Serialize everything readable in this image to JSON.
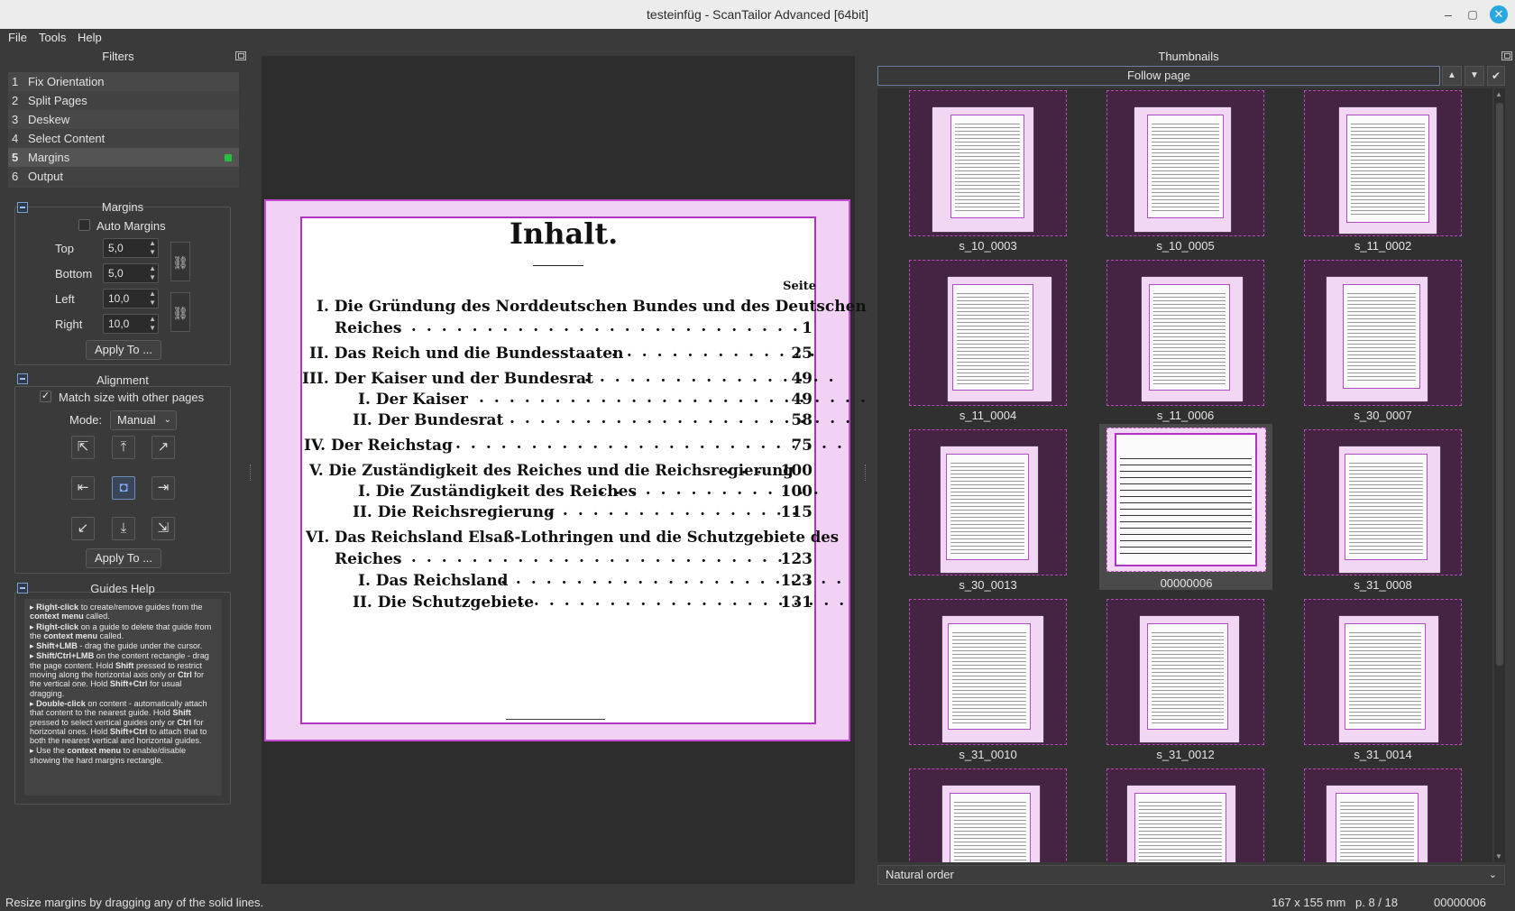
{
  "window": {
    "title": "testeinfüg - ScanTailor Advanced [64bit]"
  },
  "menu": [
    "File",
    "Tools",
    "Help"
  ],
  "filters": {
    "title": "Filters",
    "items": [
      {
        "num": "1",
        "label": "Fix Orientation"
      },
      {
        "num": "2",
        "label": "Split Pages"
      },
      {
        "num": "3",
        "label": "Deskew"
      },
      {
        "num": "4",
        "label": "Select Content"
      },
      {
        "num": "5",
        "label": "Margins"
      },
      {
        "num": "6",
        "label": "Output"
      }
    ],
    "active": "5"
  },
  "margins": {
    "title": "Margins",
    "auto_label": "Auto Margins",
    "top_label": "Top",
    "top": "5,0",
    "bottom_label": "Bottom",
    "bottom": "5,0",
    "left_label": "Left",
    "left": "10,0",
    "right_label": "Right",
    "right": "10,0",
    "apply": "Apply To ..."
  },
  "alignment": {
    "title": "Alignment",
    "match_label": "Match size with other pages",
    "mode_label": "Mode:",
    "mode": "Manual",
    "apply": "Apply To ..."
  },
  "guides": {
    "title": "Guides Help"
  },
  "toc": {
    "title": "Inhalt.",
    "seite": "Seite",
    "e1a": "I. Die Gründung des Norddeutschen Bundes und des Deutschen",
    "e1b": "Reiches",
    "p1": "1",
    "e2": "II. Das Reich und die Bundesstaaten",
    "p2": "25",
    "e3": "III. Der Kaiser und der Bundesrat",
    "p3": "49",
    "e4": "I. Der Kaiser",
    "p4": "49",
    "e5": "II. Der Bundesrat",
    "p5": "58",
    "e6": "IV. Der Reichstag",
    "p6": "75",
    "e7": "V. Die Zuständigkeit des Reiches und die Reichsregierung",
    "p7": "100",
    "e8": "I. Die Zuständigkeit des Reiches",
    "p8": "100",
    "e9": "II. Die Reichsregierung",
    "p9": "115",
    "e10a": "VI. Das Reichsland Elsaß-Lothringen und die Schutzgebiete des",
    "e10b": "Reiches",
    "p10": "123",
    "e11": "I. Das Reichsland",
    "p11": "123",
    "e12": "II. Die Schutzgebiete",
    "p12": "131"
  },
  "thumbnails": {
    "title": "Thumbnails",
    "follow": "Follow page",
    "order": "Natural order",
    "items": [
      "s_10_0003",
      "s_10_0005",
      "s_11_0002",
      "s_11_0004",
      "s_11_0006",
      "s_30_0007",
      "s_30_0013",
      "00000006",
      "s_31_0008",
      "s_31_0010",
      "s_31_0012",
      "s_31_0014"
    ],
    "current": "00000006"
  },
  "status": {
    "hint": "Resize margins by dragging any of the solid lines.",
    "size": "167 x 155 mm",
    "page": "p. 8 / 18",
    "name": "00000006"
  },
  "colors": {
    "accent": "#c34bd1",
    "active_dot": "#22c33a",
    "close": "#27a8e0"
  }
}
